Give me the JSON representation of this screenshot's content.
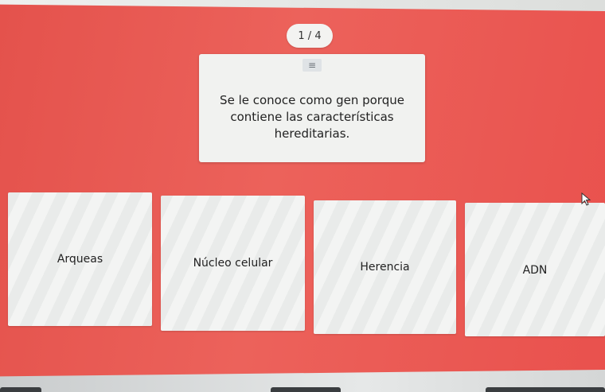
{
  "progress": {
    "text": "1 / 4"
  },
  "question": {
    "handle_icon": "drag-handle-icon",
    "text": "Se le conoce como gen porque contiene las características hereditarias."
  },
  "options": [
    {
      "label": "Arqueas"
    },
    {
      "label": "Núcleo celular"
    },
    {
      "label": "Herencia"
    },
    {
      "label": "ADN"
    }
  ],
  "colors": {
    "background": "#e9574f",
    "card": "#f1f2f0",
    "pill": "#f3f3f1"
  }
}
